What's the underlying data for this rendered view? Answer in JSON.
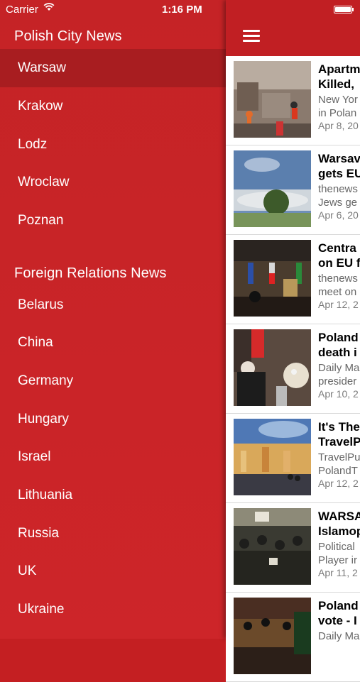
{
  "status_bar": {
    "carrier": "Carrier",
    "time": "1:16 PM"
  },
  "drawer": {
    "section1_title": "Polish City News",
    "cities": [
      "Warsaw",
      "Krakow",
      "Lodz",
      "Wroclaw",
      "Poznan"
    ],
    "selected": "Warsaw",
    "section2_title": "Foreign Relations News",
    "countries": [
      "Belarus",
      "China",
      "Germany",
      "Hungary",
      "Israel",
      "Lithuania",
      "Russia",
      "UK",
      "Ukraine"
    ]
  },
  "news": [
    {
      "headline_l1": "Apartm",
      "headline_l2": "Killed,",
      "source_l1": "New Yor",
      "source_l2": "in Polan",
      "date": "Apr 8, 20"
    },
    {
      "headline_l1": "Warsav",
      "headline_l2": "gets EU",
      "source_l1": "thenews",
      "source_l2": "Jews ge",
      "date": "Apr 6, 20"
    },
    {
      "headline_l1": "Centra",
      "headline_l2": "on EU f",
      "source_l1": "thenews",
      "source_l2": "meet on",
      "date": "Apr 12, 2"
    },
    {
      "headline_l1": "Poland",
      "headline_l2": "death i",
      "source_l1": "Daily Ma",
      "source_l2": "presider",
      "date": "Apr 10, 2"
    },
    {
      "headline_l1": "It's The",
      "headline_l2": "TravelP",
      "source_l1": "TravelPu",
      "source_l2": "PolandT",
      "date": "Apr 12, 2"
    },
    {
      "headline_l1": "WARSA",
      "headline_l2": "Islamop",
      "source_l1": "Political",
      "source_l2": "Player ir",
      "date": "Apr 11, 2"
    },
    {
      "headline_l1": "Poland",
      "headline_l2": "vote - I",
      "source_l1": "Daily Ma",
      "source_l2": "",
      "date": ""
    }
  ],
  "colors": {
    "drawer_bg": "#c52326",
    "selected_bg": "#a81d20",
    "navbar_bg": "#c11f23"
  },
  "icons": {
    "menu": "hamburger-icon",
    "wifi": "wifi-icon",
    "battery": "battery-icon"
  }
}
